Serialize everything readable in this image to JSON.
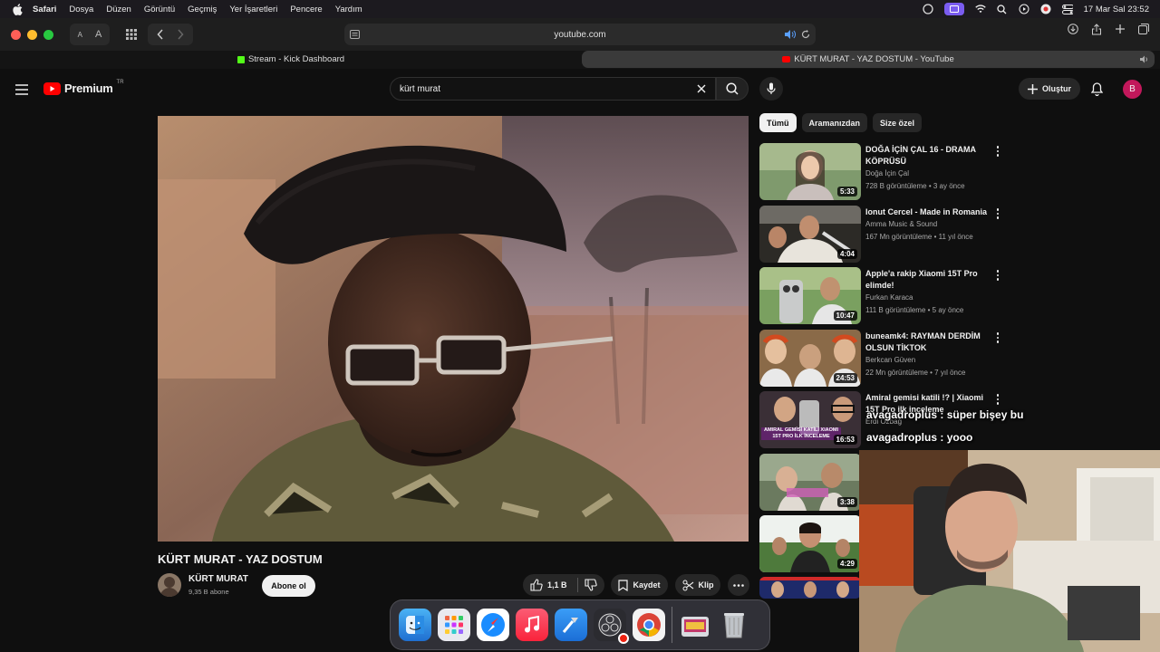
{
  "menubar": {
    "app": "Safari",
    "items": [
      "Dosya",
      "Düzen",
      "Görüntü",
      "Geçmiş",
      "Yer İşaretleri",
      "Pencere",
      "Yardım"
    ],
    "datetime": "17 Mar Sal  23:52"
  },
  "toolbar": {
    "font_small": "A",
    "font_large": "A",
    "address": "youtube.com"
  },
  "tabs": [
    {
      "label": "Stream - Kick Dashboard"
    },
    {
      "label": "KÜRT MURAT - YAZ DOSTUM - YouTube"
    }
  ],
  "youtube": {
    "logo_text": "Premium",
    "region": "TR",
    "search_value": "kürt murat",
    "create_label": "Oluştur",
    "avatar_letter": "B",
    "chips": [
      "Tümü",
      "Aramanızdan",
      "Size özel"
    ],
    "video": {
      "title": "KÜRT MURAT - YAZ DOSTUM",
      "channel": "KÜRT MURAT",
      "subscribers": "9,35 B abone",
      "subscribe_label": "Abone ol",
      "likes": "1,1 B",
      "save_label": "Kaydet",
      "clip_label": "Klip"
    },
    "recommendations": [
      {
        "title": "DOĞA İÇİN ÇAL 16 - DRAMA KÖPRÜSÜ",
        "channel": "Doğa İçin Çal",
        "meta": "728 B görüntüleme • 3 ay önce",
        "duration": "5:33"
      },
      {
        "title": "Ionut Cercel - Made in Romania",
        "channel": "Amma Music & Sound",
        "meta": "167 Mn görüntüleme • 11 yıl önce",
        "duration": "4:04"
      },
      {
        "title": "Apple'a rakip Xiaomi 15T Pro elimde!",
        "channel": "Furkan Karaca",
        "meta": "111 B görüntüleme • 5 ay önce",
        "duration": "10:47"
      },
      {
        "title": "buneamk4: RAYMAN DERDİM OLSUN TİKTOK",
        "channel": "Berkcan Güven",
        "meta": "22 Mn görüntüleme • 7 yıl önce",
        "duration": "24:53"
      },
      {
        "title": "Amiral gemisi katili !? | Xiaomi 15T Pro ilk inceleme",
        "channel": "Erdi Özbağ",
        "meta": "",
        "duration": "16:53",
        "thumb_text": "AMIRAL GEMİSİ KATİLİ XIAOMI 15T PRO İLK İNCELEME"
      },
      {
        "title": "",
        "channel": "",
        "meta": "",
        "duration": "3:38"
      },
      {
        "title": "",
        "channel": "",
        "meta": "",
        "duration": "4:29"
      }
    ]
  },
  "stream_chat": [
    {
      "user": "avagadroplus",
      "message": "süper bişey bu"
    },
    {
      "user": "avagadroplus",
      "message": "yooo"
    }
  ],
  "dock": [
    "finder-icon",
    "launchpad-icon",
    "safari-icon",
    "music-icon",
    "xcode-icon",
    "obs-icon",
    "chrome-icon",
    "folder-icon",
    "trash-icon"
  ],
  "colors": {
    "youtube_red": "#ff0000",
    "bg": "#0f0f0f",
    "chip_selected": "#f1f1f1",
    "avatar": "#c2185b"
  }
}
